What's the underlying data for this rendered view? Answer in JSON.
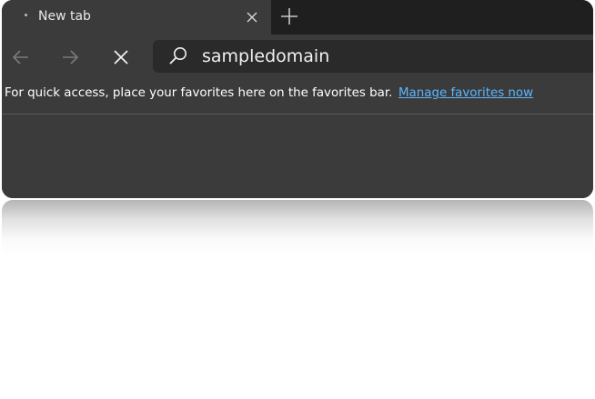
{
  "tab": {
    "title": "New tab"
  },
  "address_bar": {
    "value": "sampledomain"
  },
  "favorites_bar": {
    "message": "For quick access, place your favorites here on the favorites bar.",
    "link": "Manage favorites now"
  },
  "icons": {
    "tab_close": "close-icon",
    "new_tab": "plus-icon",
    "back": "arrow-left-icon",
    "forward": "arrow-right-icon",
    "stop": "close-icon",
    "search": "search-icon"
  },
  "colors": {
    "chrome": "#3b3b3b",
    "tabstrip": "#1f1f1f",
    "address_bg": "#2a2a2a",
    "link": "#5cb6ff"
  }
}
